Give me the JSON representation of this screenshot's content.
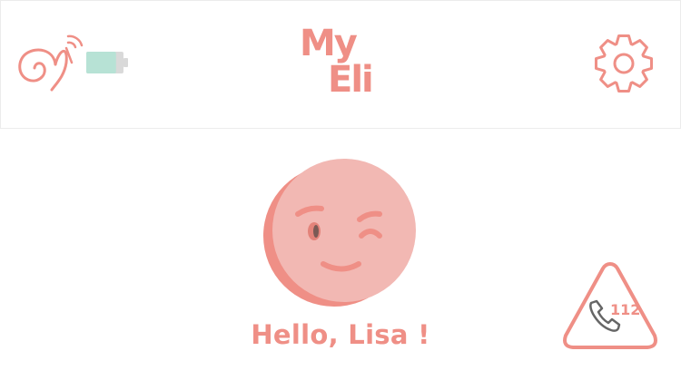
{
  "header": {
    "logo": {
      "line1": "My",
      "line2": "Eli"
    },
    "device_status": {
      "device_icon": "bluetooth-device-icon",
      "battery_icon": "battery-icon",
      "battery_level": 0.8
    },
    "settings_icon": "gear-icon"
  },
  "main": {
    "emoji_icon": "winking-face-icon",
    "greeting": "Hello, Lisa !"
  },
  "emergency": {
    "icon": "phone-icon",
    "number": "112"
  },
  "colors": {
    "accent": "#ef8f86",
    "emoji_face": "#f2b8b3",
    "emoji_shadow": "#ef8f86",
    "battery": "#b7e2d5",
    "border": "#ececec"
  }
}
